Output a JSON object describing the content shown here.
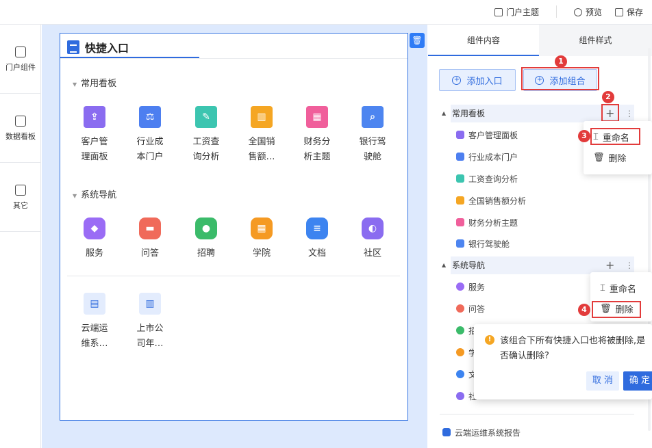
{
  "topbar": {
    "theme_label": "门户主题",
    "preview_label": "预览",
    "save_label": "保存"
  },
  "leftnav": [
    {
      "label": "门户组件",
      "icon": "grid-icon"
    },
    {
      "label": "数据看板",
      "icon": "dashboard-icon"
    },
    {
      "label": "其它",
      "icon": "document-icon"
    }
  ],
  "card": {
    "title": "快捷入口",
    "groups": [
      {
        "name": "常用看板",
        "items": [
          {
            "label": "客户管理面板",
            "color": "#8a6cf0",
            "icon": "upload-icon"
          },
          {
            "label": "行业成本门户",
            "color": "#4d7ff0",
            "icon": "scale-icon"
          },
          {
            "label": "工资查询分析",
            "color": "#3cc5b0",
            "icon": "edit-icon"
          },
          {
            "label": "全国销售额…",
            "color": "#f5a623",
            "icon": "bar-chart-icon"
          },
          {
            "label": "财务分析主题",
            "color": "#f05f9b",
            "icon": "calendar-icon"
          },
          {
            "label": "银行驾驶舱",
            "color": "#4d85f0",
            "icon": "search-chart-icon"
          }
        ]
      },
      {
        "name": "系统导航",
        "items": [
          {
            "label": "服务",
            "color": "#9a6cf5",
            "icon": "service-icon"
          },
          {
            "label": "问答",
            "color": "#f06a5a",
            "icon": "qa-icon"
          },
          {
            "label": "招聘",
            "color": "#3bbb6a",
            "icon": "recruit-icon"
          },
          {
            "label": "学院",
            "color": "#f59a23",
            "icon": "academy-icon"
          },
          {
            "label": "文档",
            "color": "#3d84f0",
            "icon": "doc-icon"
          },
          {
            "label": "社区",
            "color": "#8a6cf0",
            "icon": "community-icon"
          }
        ]
      },
      {
        "name": "",
        "items": [
          {
            "label": "云端运维系…",
            "color": "#2f6bde",
            "icon": "report-icon"
          },
          {
            "label": "上市公司年…",
            "color": "#2f6bde",
            "icon": "bar-report-icon"
          }
        ]
      }
    ]
  },
  "panel": {
    "tabs": [
      "组件内容",
      "组件样式"
    ],
    "add_entry_label": "添加入口",
    "add_group_label": "添加组合",
    "group1": {
      "name": "常用看板",
      "items": [
        "客户管理面板",
        "行业成本门户",
        "工资查询分析",
        "全国销售额分析",
        "财务分析主题",
        "银行驾驶舱"
      ]
    },
    "group2": {
      "name": "系统导航",
      "items": [
        "服务",
        "问答",
        "招",
        "学",
        "文",
        "社"
      ]
    },
    "bottom_item": "云端运维系统报告"
  },
  "menu": {
    "rename": "重命名",
    "delete": "删除"
  },
  "confirm": {
    "text": "该组合下所有快捷入口也将被删除,是否确认删除?",
    "cancel": "取 消",
    "ok": "确 定"
  },
  "badges": [
    "1",
    "2",
    "3",
    "4"
  ]
}
